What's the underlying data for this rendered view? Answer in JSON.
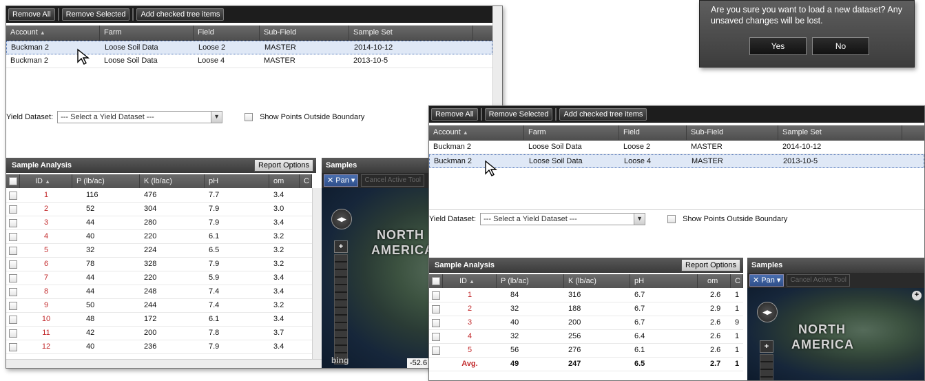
{
  "toolbar": {
    "remove_all": "Remove All",
    "remove_selected": "Remove Selected",
    "add_checked": "Add checked tree items"
  },
  "grid": {
    "columns": [
      "Account",
      "Farm",
      "Field",
      "Sub-Field",
      "Sample Set"
    ],
    "rows": [
      [
        "Buckman 2",
        "Loose Soil Data",
        "Loose 2",
        "MASTER",
        "2014-10-12"
      ],
      [
        "Buckman 2",
        "Loose Soil Data",
        "Loose 4",
        "MASTER",
        "2013-10-5"
      ]
    ]
  },
  "yield": {
    "label": "Yield Dataset:",
    "placeholder": "--- Select a Yield Dataset ---",
    "show_points": "Show Points Outside Boundary"
  },
  "sample_analysis": {
    "title": "Sample Analysis",
    "report_options": "Report Options",
    "columns": [
      "ID",
      "P (lb/ac)",
      "K (lb/ac)",
      "pH",
      "om",
      "C"
    ]
  },
  "panelA_rows": [
    [
      "1",
      "116",
      "476",
      "7.7",
      "3.4"
    ],
    [
      "2",
      "52",
      "304",
      "7.9",
      "3.0"
    ],
    [
      "3",
      "44",
      "280",
      "7.9",
      "3.4"
    ],
    [
      "4",
      "40",
      "220",
      "6.1",
      "3.2"
    ],
    [
      "5",
      "32",
      "224",
      "6.5",
      "3.2"
    ],
    [
      "6",
      "78",
      "328",
      "7.9",
      "3.2"
    ],
    [
      "7",
      "44",
      "220",
      "5.9",
      "3.4"
    ],
    [
      "8",
      "44",
      "248",
      "7.4",
      "3.4"
    ],
    [
      "9",
      "50",
      "244",
      "7.4",
      "3.2"
    ],
    [
      "10",
      "48",
      "172",
      "6.1",
      "3.4"
    ],
    [
      "11",
      "42",
      "200",
      "7.8",
      "3.7"
    ],
    [
      "12",
      "40",
      "236",
      "7.9",
      "3.4"
    ]
  ],
  "panelB_rows": [
    [
      "1",
      "84",
      "316",
      "6.7",
      "2.6",
      "1"
    ],
    [
      "2",
      "32",
      "188",
      "6.7",
      "2.9",
      "1"
    ],
    [
      "3",
      "40",
      "200",
      "6.7",
      "2.6",
      "9"
    ],
    [
      "4",
      "32",
      "256",
      "6.4",
      "2.6",
      "1"
    ],
    [
      "5",
      "56",
      "276",
      "6.1",
      "2.6",
      "1"
    ]
  ],
  "panelB_avg": [
    "Avg.",
    "49",
    "247",
    "6.5",
    "2.7",
    "1"
  ],
  "samples": {
    "title": "Samples",
    "pan": "Pan",
    "cancel_tool": "Cancel Active Tool",
    "map_label_1": "NORTH",
    "map_label_2": "AMERICA",
    "bing": "bing",
    "coord": "-52.6"
  },
  "dialog": {
    "message": "Are you sure you want to load a new dataset? Any unsaved changes will be lost.",
    "yes": "Yes",
    "no": "No"
  }
}
